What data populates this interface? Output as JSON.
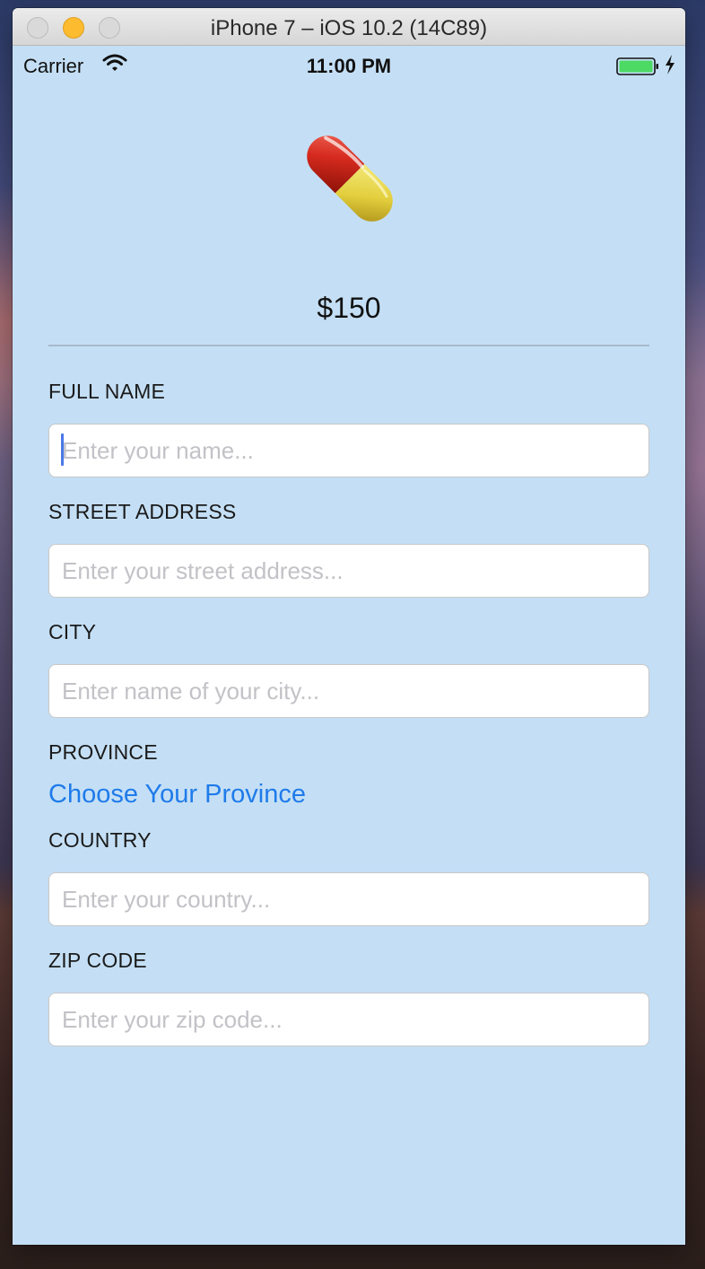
{
  "window": {
    "title": "iPhone 7 – iOS 10.2 (14C89)"
  },
  "status_bar": {
    "carrier": "Carrier",
    "time": "11:00 PM"
  },
  "product": {
    "icon": "pill-icon",
    "price": "$150"
  },
  "form": {
    "full_name": {
      "label": "FULL NAME",
      "placeholder": "Enter your name...",
      "value": ""
    },
    "street": {
      "label": "STREET ADDRESS",
      "placeholder": "Enter your street address...",
      "value": ""
    },
    "city": {
      "label": "CITY",
      "placeholder": "Enter name of your city...",
      "value": ""
    },
    "province": {
      "label": "PROVINCE",
      "button_label": "Choose Your Province"
    },
    "country": {
      "label": "COUNTRY",
      "placeholder": "Enter your country...",
      "value": ""
    },
    "zip": {
      "label": "ZIP CODE",
      "placeholder": "Enter your zip code...",
      "value": ""
    }
  },
  "colors": {
    "screen_bg": "#c4dff5",
    "link": "#1f7bea",
    "battery": "#4cd964",
    "pill_red": "#d62a1e",
    "pill_yellow": "#e8d84a"
  }
}
